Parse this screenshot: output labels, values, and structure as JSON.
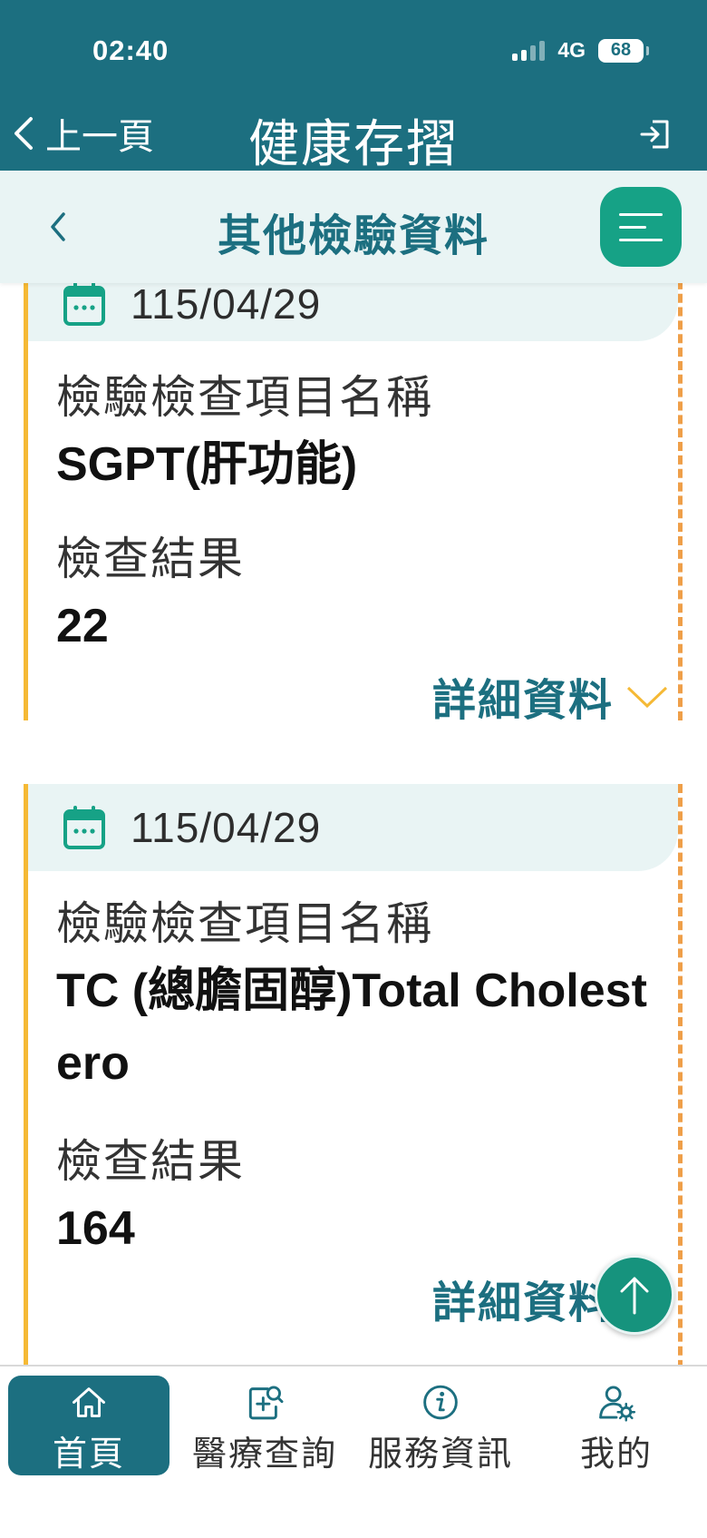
{
  "status": {
    "time": "02:40",
    "network": "4G",
    "battery": "68"
  },
  "header": {
    "back_label": "上一頁",
    "title": "健康存摺"
  },
  "subheader": {
    "title": "其他檢驗資料"
  },
  "records": [
    {
      "date": "115/04/29",
      "item_label": "檢驗檢查項目名稱",
      "item_name": "SGPT(肝功能)",
      "result_label": "檢查結果",
      "result": "22",
      "detail_label": "詳細資料"
    },
    {
      "date": "115/04/29",
      "item_label": "檢驗檢查項目名稱",
      "item_name": "TC (總膽固醇)Total Cholestero",
      "result_label": "檢查結果",
      "result": "164",
      "detail_label": "詳細資料"
    }
  ],
  "nav": [
    {
      "label": "首頁",
      "icon": "home-icon",
      "active": true
    },
    {
      "label": "醫療查詢",
      "icon": "medical-search-icon",
      "active": false
    },
    {
      "label": "服務資訊",
      "icon": "info-icon",
      "active": false
    },
    {
      "label": "我的",
      "icon": "user-settings-icon",
      "active": false
    }
  ],
  "colors": {
    "primary": "#1c6f80",
    "accent": "#16a286",
    "left_border": "#f5b935",
    "dashed_border": "#ef9f49",
    "light_bg": "#e9f4f4"
  }
}
